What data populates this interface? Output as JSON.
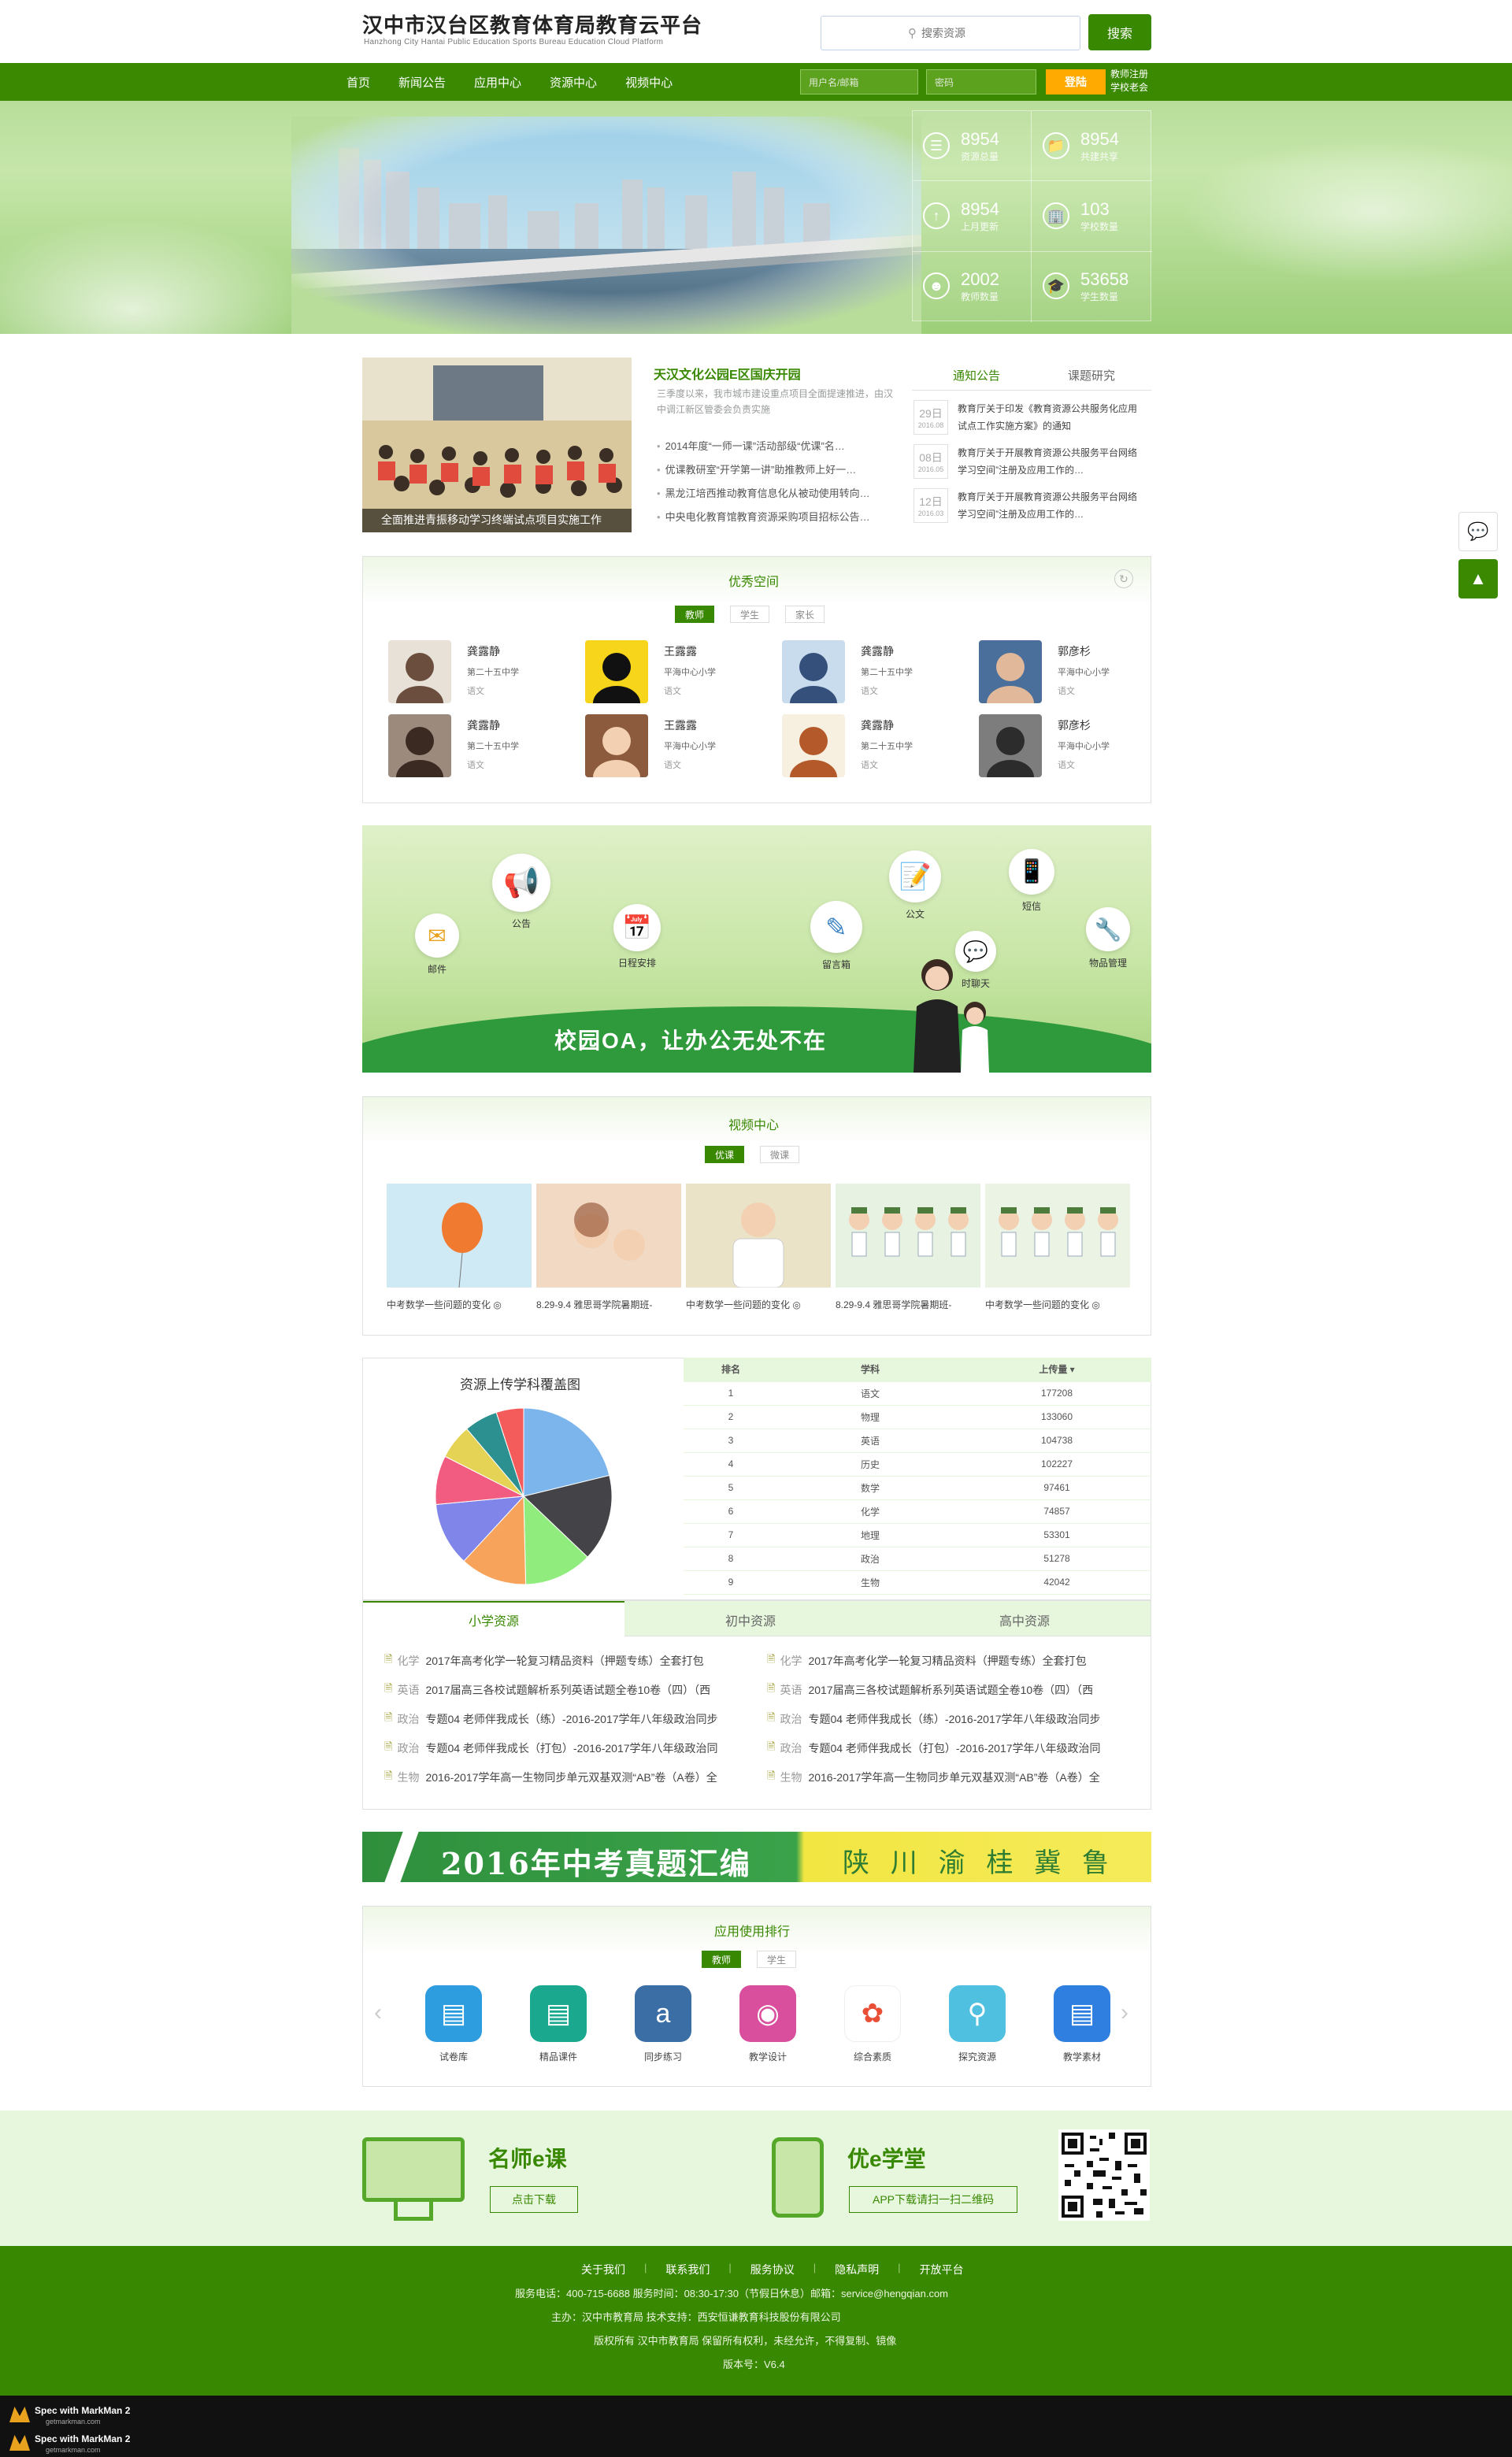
{
  "header": {
    "title": "汉中市汉台区教育体育局教育云平台",
    "subtitle": "Hanzhong City Hantai Public Education Sports Bureau Education Cloud Platform",
    "search_placeholder": "搜索资源",
    "search_button": "搜索"
  },
  "nav": {
    "items": [
      "首页",
      "新闻公告",
      "应用中心",
      "资源中心",
      "视频中心"
    ],
    "username_placeholder": "用户名/邮箱",
    "password_placeholder": "密码",
    "login_button": "登陆",
    "register_link": "教师注册",
    "school_register_link": "学校老会"
  },
  "stats": [
    {
      "value": "8954",
      "label": "资源总量",
      "icon": "book-stack-icon"
    },
    {
      "value": "8954",
      "label": "共建共享",
      "icon": "folder-image-icon"
    },
    {
      "value": "8954",
      "label": "上月更新",
      "icon": "arrow-up-icon"
    },
    {
      "value": "103",
      "label": "学校数量",
      "icon": "building-icon"
    },
    {
      "value": "2002",
      "label": "教师数量",
      "icon": "teacher-icon"
    },
    {
      "value": "53658",
      "label": "学生数量",
      "icon": "student-icon"
    }
  ],
  "news": {
    "photo_caption": "全面推进青振移动学习终端试点项目实施工作",
    "headline": "天汉文化公园E区国庆开园",
    "summary": "三季度以来，我市城市建设重点项目全面提速推进，由汉中调江新区管委会负责实施",
    "items": [
      "2014年度“一师一课”活动部级“优课”名…",
      "优课教研室“开学第一讲”助推教师上好一…",
      "黑龙江培西推动教育信息化从被动使用转向…",
      "中央电化教育馆教育资源采购项目招标公告…"
    ]
  },
  "notice": {
    "tabs": [
      "通知公告",
      "课题研究"
    ],
    "items": [
      {
        "day": "29日",
        "date": "2016.08",
        "text": "教育厅关于印发《教育资源公共服务化应用试点工作实施方案》的通知"
      },
      {
        "day": "08日",
        "date": "2016.05",
        "text": "教育厅关于开展教育资源公共服务平台网络学习空间”注册及应用工作的…"
      },
      {
        "day": "12日",
        "date": "2016.03",
        "text": "教育厅关于开展教育资源公共服务平台网络学习空间”注册及应用工作的…"
      }
    ]
  },
  "excellent": {
    "title": "优秀空间",
    "tabs": [
      "教师",
      "学生",
      "家长"
    ],
    "people": [
      {
        "name": "龚露静",
        "school": "第二十五中学",
        "subject": "语文"
      },
      {
        "name": "王露露",
        "school": "平海中心小学",
        "subject": "语文"
      },
      {
        "name": "龚露静",
        "school": "第二十五中学",
        "subject": "语文"
      },
      {
        "name": "郭彦杉",
        "school": "平海中心小学",
        "subject": "语文"
      },
      {
        "name": "龚露静",
        "school": "第二十五中学",
        "subject": "语文"
      },
      {
        "name": "王露露",
        "school": "平海中心小学",
        "subject": "语文"
      },
      {
        "name": "龚露静",
        "school": "第二十五中学",
        "subject": "语文"
      },
      {
        "name": "郭彦杉",
        "school": "平海中心小学",
        "subject": "语文"
      }
    ]
  },
  "oa": {
    "slogan": "校园OA，让办公无处不在",
    "icons": [
      "邮件",
      "公告",
      "日程安排",
      "留言箱",
      "公文",
      "短信",
      "物品管理",
      "时聊天"
    ]
  },
  "video": {
    "title": "视频中心",
    "tabs": [
      "优课",
      "微课"
    ],
    "items": [
      "中考数学一些问题的变化 ◎",
      "8.29-9.4 雅思哥学院暑期班-",
      "中考数学一些问题的变化 ◎",
      "8.29-9.4 雅思哥学院暑期班-",
      "中考数学一些问题的变化 ◎"
    ]
  },
  "chart_data": {
    "type": "pie",
    "title": "资源上传学科覆盖图",
    "categories": [
      "语文",
      "物理",
      "英语",
      "历史",
      "数学",
      "化学",
      "地理",
      "政治",
      "生物"
    ],
    "values": [
      177208,
      133060,
      104738,
      102227,
      97461,
      74857,
      53301,
      51278,
      42042
    ],
    "colors": [
      "#7cb5ec",
      "#434348",
      "#90ed7d",
      "#f7a35c",
      "#8085e9",
      "#f15c80",
      "#e4d354",
      "#2b908f",
      "#f45b5b"
    ]
  },
  "rank_table": {
    "headers": [
      "排名",
      "学科",
      "上传量 ▾"
    ],
    "rows": [
      [
        "1",
        "语文",
        "177208"
      ],
      [
        "2",
        "物理",
        "133060"
      ],
      [
        "3",
        "英语",
        "104738"
      ],
      [
        "4",
        "历史",
        "102227"
      ],
      [
        "5",
        "数学",
        "97461"
      ],
      [
        "6",
        "化学",
        "74857"
      ],
      [
        "7",
        "地理",
        "53301"
      ],
      [
        "8",
        "政治",
        "51278"
      ],
      [
        "9",
        "生物",
        "42042"
      ]
    ]
  },
  "resources": {
    "tabs": [
      "小学资源",
      "初中资源",
      "高中资源"
    ],
    "left": [
      {
        "tag": "化学",
        "text": "2017年高考化学一轮复习精品资料（押题专练）全套打包"
      },
      {
        "tag": "英语",
        "text": "2017届高三各校试题解析系列英语试题全卷10卷（四）（西"
      },
      {
        "tag": "政治",
        "text": "专题04 老师伴我成长（练）-2016-2017学年八年级政治同步"
      },
      {
        "tag": "政治",
        "text": "专题04 老师伴我成长（打包）-2016-2017学年八年级政治同"
      },
      {
        "tag": "生物",
        "text": "2016-2017学年高一生物同步单元双基双测“AB”卷（A卷）全"
      }
    ],
    "right": [
      {
        "tag": "化学",
        "text": "2017年高考化学一轮复习精品资料（押题专练）全套打包"
      },
      {
        "tag": "英语",
        "text": "2017届高三各校试题解析系列英语试题全卷10卷（四）（西"
      },
      {
        "tag": "政治",
        "text": "专题04 老师伴我成长（练）-2016-2017学年八年级政治同步"
      },
      {
        "tag": "政治",
        "text": "专题04 老师伴我成长（打包）-2016-2017学年八年级政治同"
      },
      {
        "tag": "生物",
        "text": "2016-2017学年高一生物同步单元双基双测“AB”卷（A卷）全"
      }
    ]
  },
  "banner": {
    "main": "2016年中考真题汇编",
    "provinces": "陕 川 渝 桂 冀 鲁"
  },
  "apps": {
    "title": "应用使用排行",
    "tabs": [
      "教师",
      "学生"
    ],
    "items": [
      {
        "label": "试卷库",
        "color": "#2e9de0",
        "icon": "paper-icon"
      },
      {
        "label": "精品课件",
        "color": "#1aa88f",
        "icon": "presentation-icon"
      },
      {
        "label": "同步练习",
        "color": "#3a6ea5",
        "icon": "pen-icon"
      },
      {
        "label": "教学设计",
        "color": "#d94f9e",
        "icon": "design-icon"
      },
      {
        "label": "综合素质",
        "color": "#ffffff",
        "icon": "colorful-icon"
      },
      {
        "label": "探究资源",
        "color": "#4fc0e0",
        "icon": "search-doc-icon"
      },
      {
        "label": "教学素材",
        "color": "#2e7fe0",
        "icon": "notebook-icon"
      }
    ]
  },
  "promo": {
    "left_title": "名师e课",
    "left_button": "点击下载",
    "right_title": "优e学堂",
    "right_button": "APP下载请扫一扫二维码"
  },
  "footer": {
    "links": [
      "关于我们",
      "联系我们",
      "服务协议",
      "隐私声明",
      "开放平台"
    ],
    "contact": "服务电话：400-715-6688  服务时间：08:30-17:30（节假日休息）邮箱：service@hengqian.com",
    "host": "主办：汉中市教育局  技术支持：西安恒谦教育科技股份有限公司",
    "copyright": "版权所有 汉中市教育局 保留所有权利，未经允许，不得复制、镜像",
    "version": "版本号：V6.4"
  },
  "markman": [
    "Spec with MarkMan 2",
    "getmarkman.com"
  ]
}
